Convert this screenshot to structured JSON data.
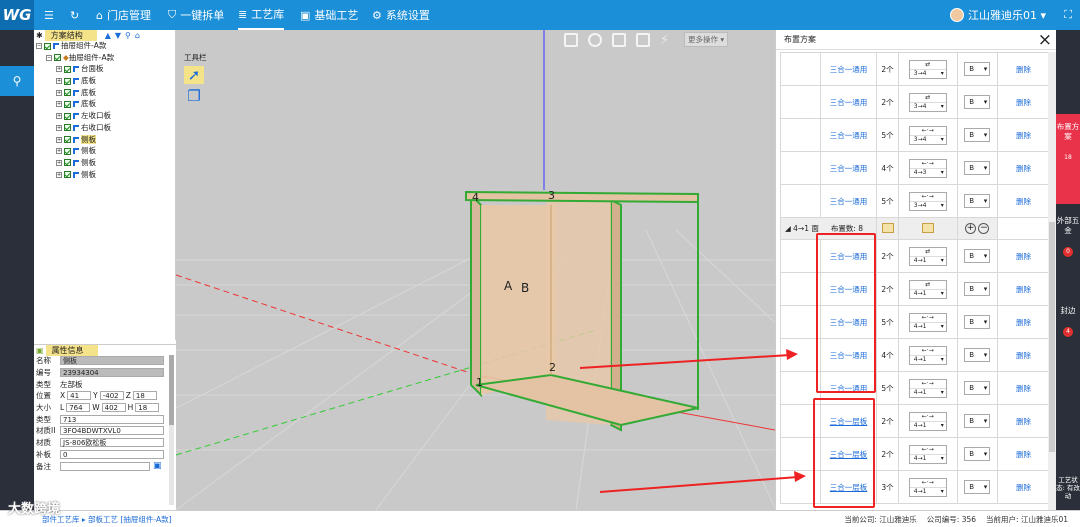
{
  "app": {
    "logo": "WG",
    "menu_icon": "hamburger-icon",
    "refresh_icon": "refresh-icon"
  },
  "nav": [
    {
      "label": "门店管理",
      "icon": "home-icon"
    },
    {
      "label": "一键拆单",
      "icon": "shield-icon"
    },
    {
      "label": "工艺库",
      "icon": "list-icon"
    },
    {
      "label": "基础工艺",
      "icon": "folder-icon"
    },
    {
      "label": "系统设置",
      "icon": "gear-icon"
    }
  ],
  "user": {
    "name": "江山雅迪乐01 ▾"
  },
  "tree": {
    "title": "方案结构",
    "root": "抽屉组件-A款",
    "child": "抽屉组件-A款",
    "items": [
      "台面板",
      "底板",
      "底板",
      "底板",
      "左收口板",
      "右收口板",
      "侧板",
      "侧板",
      "侧板",
      "侧板"
    ]
  },
  "props": {
    "title": "属性信息",
    "name_l": "名称",
    "name_v": "侧板",
    "code_l": "编号",
    "code_v": "23934304",
    "type_l": "类型",
    "type_v": "左部板",
    "pos_l": "位置",
    "x_l": "X",
    "x_v": "41",
    "y_l": "Y",
    "y_v": "-402",
    "z_l": "Z",
    "z_v": "18",
    "size_l": "大小",
    "l_l": "L",
    "l_v": "764",
    "w_l": "W",
    "w_v": "402",
    "h_l": "H",
    "h_v": "18",
    "kind_l": "类型",
    "kind_v": "713",
    "mat1_l": "材质II",
    "mat1_v": "3FO4BDWTXVL0",
    "mat2_l": "材质",
    "mat2_v": "JS-806欧松板",
    "plate_l": "补板",
    "plate_v": "0",
    "note_l": "备注",
    "note_v": ""
  },
  "viewport": {
    "tool_label": "工具栏",
    "more_ops": "更多操作 ▾",
    "labels": [
      "4",
      "3",
      "A",
      "B",
      "1",
      "2"
    ]
  },
  "dialog": {
    "title": "布置方案",
    "close": "×"
  },
  "rows_top": [
    {
      "name": "三合一通用",
      "count": "2个",
      "dir": "3→4",
      "arr": "⇄",
      "b": "B",
      "del": "删除"
    },
    {
      "name": "三合一通用",
      "count": "2个",
      "dir": "3→4",
      "arr": "⇄",
      "b": "B",
      "del": "删除"
    },
    {
      "name": "三合一通用",
      "count": "5个",
      "dir": "3→4",
      "arr": "←·→",
      "b": "B",
      "del": "删除"
    },
    {
      "name": "三合一通用",
      "count": "4个",
      "dir": "4→3",
      "arr": "←·→",
      "b": "B",
      "del": "删除"
    },
    {
      "name": "三合一通用",
      "count": "5个",
      "dir": "3→4",
      "arr": "←·→",
      "b": "B",
      "del": "删除"
    }
  ],
  "group": {
    "label": "◢ 4→1 面",
    "count": "布置数: 8",
    "plus": "+",
    "minus": "−"
  },
  "rows_bottom": [
    {
      "name": "三合一通用",
      "count": "2个",
      "dir": "4→1",
      "arr": "⇄",
      "b": "B",
      "del": "删除"
    },
    {
      "name": "三合一通用",
      "count": "2个",
      "dir": "4→1",
      "arr": "⇄",
      "b": "B",
      "del": "删除"
    },
    {
      "name": "三合一通用",
      "count": "5个",
      "dir": "4→1",
      "arr": "←·→",
      "b": "B",
      "del": "删除"
    },
    {
      "name": "三合一通用",
      "count": "4个",
      "dir": "4→1",
      "arr": "←·→",
      "b": "B",
      "del": "删除"
    },
    {
      "name": "三合一通用",
      "count": "5个",
      "dir": "4→1",
      "arr": "←·→",
      "b": "B",
      "del": "删除"
    },
    {
      "name": "三合一层板",
      "count": "2个",
      "dir": "4→1",
      "arr": "←·→",
      "b": "B",
      "del": "删除"
    },
    {
      "name": "三合一层板",
      "count": "2个",
      "dir": "4→1",
      "arr": "←·→",
      "b": "B",
      "del": "删除"
    },
    {
      "name": "三合一层板",
      "count": "3个",
      "dir": "4→1",
      "arr": "←·→",
      "b": "B",
      "del": "删除"
    }
  ],
  "rightrail": {
    "tab1": "布置方案",
    "tab1_count": "18",
    "tab2": "外部五金",
    "tab2_count": "0",
    "tab3": "封边",
    "tab3_count": "4",
    "status": "工艺状态: 有改动"
  },
  "bottom": {
    "crumb": "部件工艺库 ▸ 部板工艺 [抽屉组件-A款]",
    "company": "当前公司: 江山雅迪乐",
    "company_no": "公司编号: 356",
    "user": "当前用户: 江山雅迪乐01"
  },
  "watermark": "大数跨境"
}
